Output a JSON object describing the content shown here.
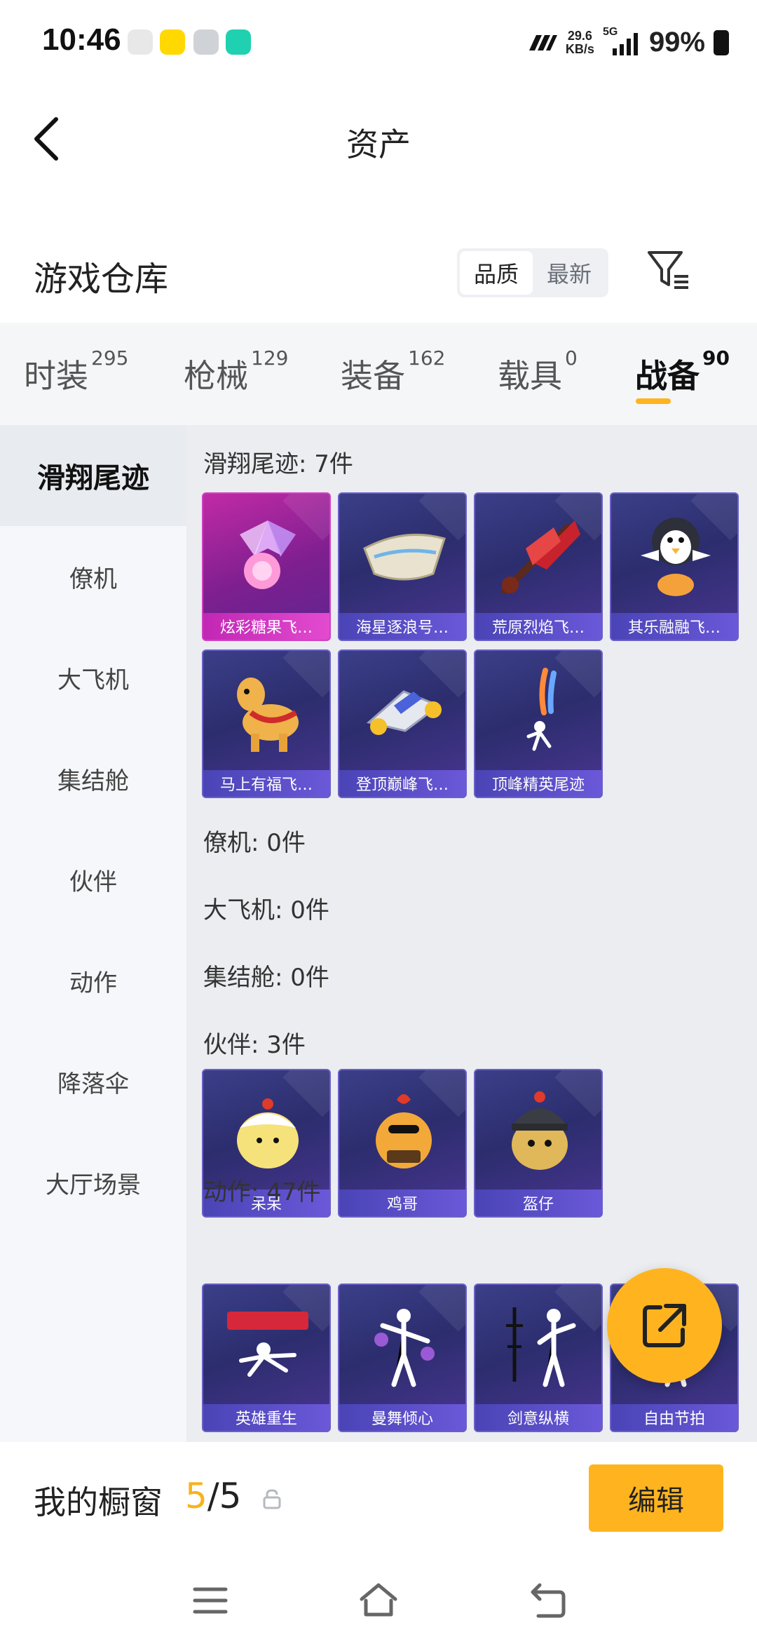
{
  "status_bar": {
    "time": "10:46",
    "net_speed_value": "29.6",
    "net_speed_unit": "KB/s",
    "network": "5G",
    "battery": "99%"
  },
  "header": {
    "title": "资产"
  },
  "warehouse": {
    "title": "游戏仓库",
    "sort_options": [
      "品质",
      "最新"
    ],
    "active_sort": "品质"
  },
  "tabs": [
    {
      "label": "时装",
      "count": "295"
    },
    {
      "label": "枪械",
      "count": "129"
    },
    {
      "label": "装备",
      "count": "162"
    },
    {
      "label": "载具",
      "count": "0"
    },
    {
      "label": "战备",
      "count": "90"
    }
  ],
  "active_tab": "战备",
  "sidebar": [
    "滑翔尾迹",
    "僚机",
    "大飞机",
    "集结舱",
    "伙伴",
    "动作",
    "降落伞",
    "大厅场景"
  ],
  "active_sidebar": "滑翔尾迹",
  "sections": {
    "trail_title": "滑翔尾迹: 7件",
    "trail_items": [
      "炫彩糖果飞…",
      "海星逐浪号…",
      "荒原烈焰飞…",
      "其乐融融飞…",
      "马上有福飞…",
      "登顶巅峰飞…",
      "顶峰精英尾迹"
    ],
    "wingman_title": "僚机: 0件",
    "plane_title": "大飞机: 0件",
    "capsule_title": "集结舱: 0件",
    "companion_title": "伙伴: 3件",
    "companion_items": [
      "呆呆",
      "鸡哥",
      "盔仔"
    ],
    "emote_title": "动作: 47件",
    "emote_items": [
      "英雄重生",
      "曼舞倾心",
      "剑意纵横",
      "自由节拍"
    ]
  },
  "bottom_bar": {
    "label": "我的橱窗",
    "current": "5",
    "total": "/5",
    "edit_button": "编辑"
  },
  "colors": {
    "accent": "#ffb41f",
    "card_purple": "#3b3f88",
    "card_pink": "#c12aa6"
  }
}
